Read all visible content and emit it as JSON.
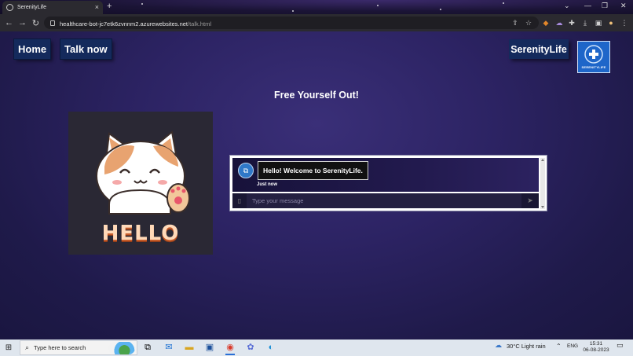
{
  "browser": {
    "tab_title": "SerenityLife",
    "url_host": "healthcare-bot-jc7etk6zvnnm2.azurewebsites.net",
    "url_path": "/talk.html"
  },
  "nav": {
    "home_label": "Home",
    "talk_label": "Talk now",
    "brand_label": "SerenityLife",
    "logo_text": "SERENITYLIFE"
  },
  "main": {
    "headline": "Free Yourself Out!",
    "image_caption": "HELLO"
  },
  "chat": {
    "welcome_message": "Hello! Welcome to SerenityLife.",
    "timestamp": "Just now",
    "input_placeholder": "Type your message"
  },
  "taskbar": {
    "search_placeholder": "Type here to search",
    "weather": "30°C  Light rain",
    "language": "ENG",
    "time": "15:31",
    "date": "06-08-2023"
  },
  "colors": {
    "page_bg": "#2c2363",
    "nav_button_bg": "#142a5c",
    "logo_bg": "#1e66c9"
  }
}
